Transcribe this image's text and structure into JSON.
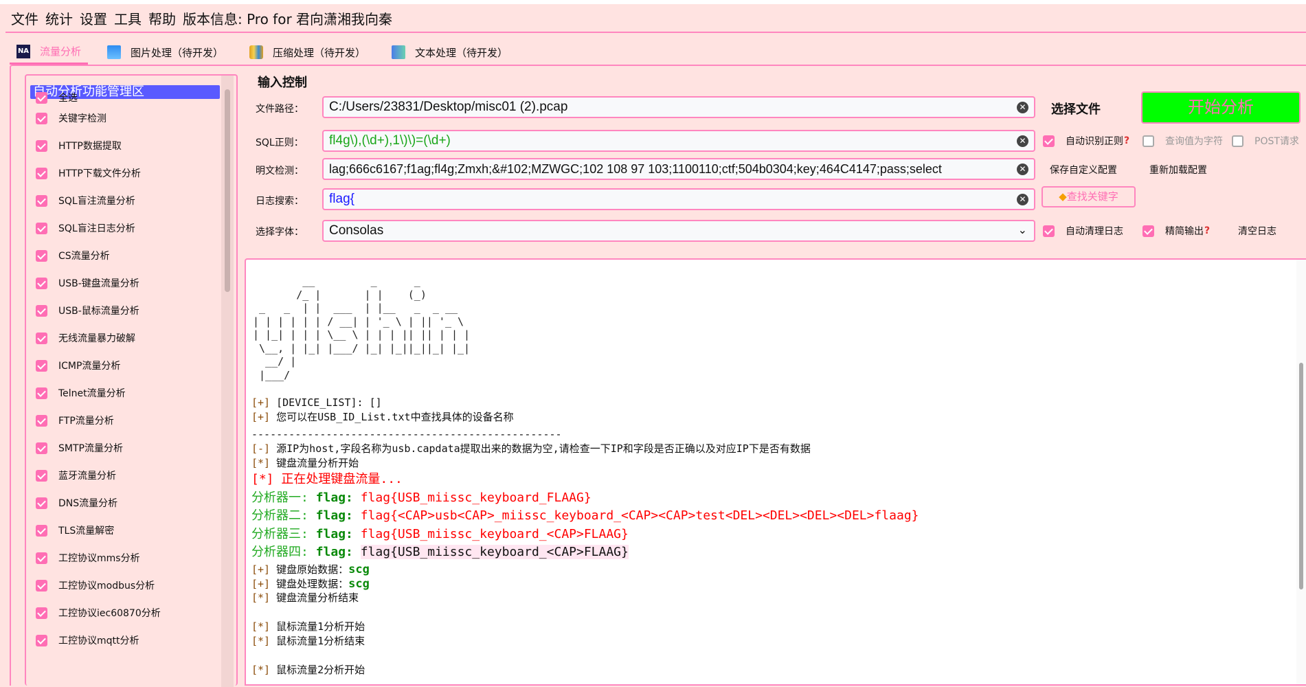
{
  "menu": [
    "文件",
    "统计",
    "设置",
    "工具",
    "帮助",
    "版本信息: Pro for 君向潇湘我向秦"
  ],
  "tabs": [
    {
      "label": "流量分析",
      "icon": "na-icon",
      "active": true
    },
    {
      "label": "图片处理（待开发）",
      "icon": "image-icon"
    },
    {
      "label": "压缩处理（待开发）",
      "icon": "archive-icon"
    },
    {
      "label": "文本处理（待开发）",
      "icon": "document-icon"
    }
  ],
  "sidebar": {
    "title": "自动分析功能管理区",
    "items": [
      "全选",
      "关键字检测",
      "HTTP数据提取",
      "HTTP下载文件分析",
      "SQL盲注流量分析",
      "SQL盲注日志分析",
      "CS流量分析",
      "USB-键盘流量分析",
      "USB-鼠标流量分析",
      "无线流量暴力破解",
      "ICMP流量分析",
      "Telnet流量分析",
      "FTP流量分析",
      "SMTP流量分析",
      "蓝牙流量分析",
      "DNS流量分析",
      "TLS流量解密",
      "工控协议mms分析",
      "工控协议modbus分析",
      "工控协议iec60870分析",
      "工控协议mqtt分析"
    ]
  },
  "input": {
    "section": "输入控制",
    "file_label": "文件路径：",
    "file_value": "C:/Users/23831/Desktop/misc01 (2).pcap",
    "sql_label": "SQL正则：",
    "sql_value": "fl4g\\),(\\d+),1\\)\\)=(\\d+)",
    "plain_label": "明文检测：",
    "plain_value": "lag;666c6167;f1ag;fl4g;Zmxh;&#102;MZWGC;102 108 97 103;1100110;ctf;504b0304;key;464C4147;pass;select",
    "log_label": "日志搜索：",
    "log_value": "flag{",
    "font_label": "选择字体：",
    "font_value": "Consolas"
  },
  "controls": {
    "select_file": "选择文件",
    "start": "开始分析",
    "auto_regex": "自动识别正则",
    "query_char": "查询值为字符",
    "post": "POST请求",
    "save_config": "保存自定义配置",
    "reload_config": "重新加载配置",
    "find_keyword": "查找关键字",
    "auto_clear": "自动清理日志",
    "simple_output": "精简输出",
    "clear_log": "清空日志",
    "auto_regex_checked": true,
    "query_char_checked": false,
    "post_checked": false,
    "auto_clear_checked": true,
    "simple_output_checked": true
  },
  "colors": {
    "accent": "#ff6eb4",
    "start_bg": "#00ff00",
    "header_bg": "#5a5aff",
    "panel_bg": "#ffe3e1"
  },
  "log": {
    "ascii": "        __         _      _\n       /_ |       | |    (_)\n _   _  | |  ___  | |__   _  _ __\n| | | | | | / __| | '_ \\ | || '_ \\\n| |_| | | | \\__ \\ | | | || || | | |\n \\__, | |_| |___/ |_| |_||_||_| |_|\n  __/ |\n |___/",
    "l1": "[DEVICE_LIST]: []",
    "l2": "您可以在USB_ID_List.txt中查找具体的设备名称",
    "sep": "--------------------------------------------------",
    "l3": "源IP为host,字段名称为usb.capdata提取出来的数据为空,请检查一下IP和字段是否正确以及对应IP下是否有数据",
    "l4": "键盘流量分析开始",
    "l5": "正在处理键盘流量...",
    "a1": "分析器一:",
    "a2": "分析器二:",
    "a3": "分析器三:",
    "a4": "分析器四:",
    "flag": "flag:",
    "f1": "flag{USB_miissc_keyboard_FLAAG}",
    "f2": "flag{<CAP>usb<CAP>_miissc_keyboard_<CAP><CAP>test<DEL><DEL><DEL><DEL>flaag}",
    "f3": "flag{USB_miissc_keyboard_<CAP>FLAAG}",
    "f4": "flag{USB_miissc_keyboard_<CAP>FLAAG}",
    "raw_label": "键盘原始数据：",
    "raw": "scg",
    "proc_label": "键盘处理数据：",
    "proc": "scg",
    "l6": "键盘流量分析结束",
    "m1": "鼠标流量1分析开始",
    "m2": "鼠标流量1分析结束",
    "m3": "鼠标流量2分析开始",
    "p_plus": "[+]",
    "p_minus": "[-]",
    "p_star": "[*]"
  }
}
